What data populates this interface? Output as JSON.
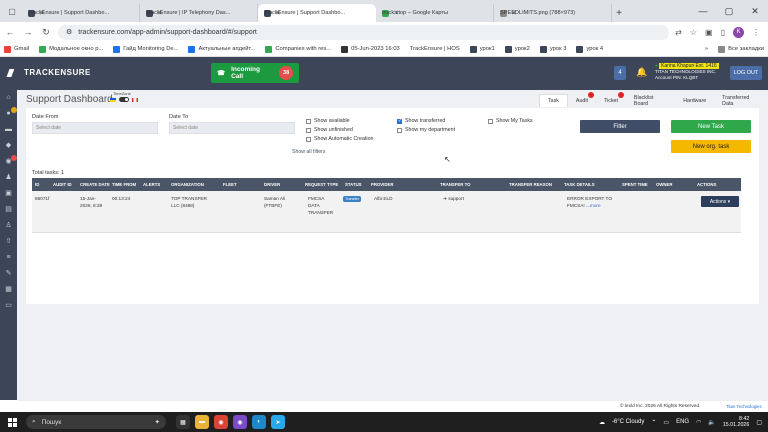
{
  "browser": {
    "tabs": [
      {
        "label": "TrackEnsure | Support Dashbo...",
        "fav": "#3c4658",
        "active": false
      },
      {
        "label": "TrackEnsure | IP Telephony Das...",
        "fav": "#3c4658",
        "active": false
      },
      {
        "label": "TrackEnsure | Support Dashbo...",
        "fav": "#3c4658",
        "active": true
      },
      {
        "label": "truck stop – Google Карты",
        "fav": "#34a853",
        "active": false
      },
      {
        "label": "SPEEDLIMITS.png (788×973)",
        "fav": "#888888",
        "active": false
      }
    ],
    "url": "trackensure.com/app-admin/support-dashboard/#/support",
    "profile_initial": "K",
    "bookmarks": [
      {
        "label": "Gmail",
        "color": "#ea4335"
      },
      {
        "label": "Модальное окно р...",
        "color": "#34a853"
      },
      {
        "label": "Гайд Monitoring De...",
        "color": "#1a73e8"
      },
      {
        "label": "Актуальные апдейт...",
        "color": "#1a73e8"
      },
      {
        "label": "Companies with res...",
        "color": "#34a853"
      },
      {
        "label": "05-Jun-2023 16:03",
        "color": "#333333"
      },
      {
        "label": "TrackEnsure | HOS",
        "color": "#3c4658"
      },
      {
        "label": "урок1",
        "color": "#3c4658"
      },
      {
        "label": "урок2",
        "color": "#3c4658"
      },
      {
        "label": "урок 3",
        "color": "#3c4658"
      },
      {
        "label": "урок 4",
        "color": "#3c4658"
      },
      {
        "label": "»",
        "color": "#ffffff"
      },
      {
        "label": "Все закладки",
        "color": "#888888"
      }
    ]
  },
  "header": {
    "logo": "TRACKENSURE",
    "incoming_call": "Incoming Call",
    "incoming_count": "38",
    "badge": "4",
    "user_name": "Karina Khapun Ext. 1416",
    "company": "TITAN TECHNOLOGIES INC.",
    "account_pin": "Account PIN: KLQBT",
    "logout": "LOG OUT"
  },
  "page": {
    "title": "Support Dashboard",
    "timezone_label": "TimeZone",
    "nav_tabs": [
      "Task",
      "Audit",
      "Ticket",
      "Blacklist Board",
      "Hardware",
      "Transferred Data"
    ],
    "filters": {
      "date_from_label": "Date From",
      "date_from_placeholder": "Select date",
      "date_to_label": "Date To",
      "date_to_placeholder": "Select date",
      "checkboxes": [
        {
          "label": "Show available",
          "checked": false
        },
        {
          "label": "Show unfinished",
          "checked": false
        },
        {
          "label": "Show Automatic Creation",
          "checked": false
        },
        {
          "label": "Show transferred",
          "checked": true
        },
        {
          "label": "Show my department",
          "checked": false
        },
        {
          "label": "Show My Tasks",
          "checked": false
        }
      ],
      "show_all": "Show all filters",
      "filter_btn": "Filter",
      "new_task_btn": "New Task",
      "new_org_task_btn": "New org. task"
    },
    "total_tasks": "Total tasks: 1",
    "columns": [
      "ID",
      "AUDIT ID",
      "CREATE DATE",
      "TIME FROM",
      "ALERTS",
      "ORGANIZATION",
      "FLEET",
      "DRIVER",
      "REQUEST TYPE",
      "STATUS",
      "PROVIDER",
      "TRANSFER TO",
      "TRANSFER REASON",
      "TASK DETAILS",
      "SPENT TIME",
      "OWNER",
      "ACTIONS"
    ],
    "row": {
      "id": "86071f",
      "create_date_1": "15-Jan-",
      "create_date_2": "2026, 8:28",
      "time_from": "00:13:24",
      "org_1": "TOP TRANSFER",
      "org_2": "LLC (8488)",
      "driver_1": "Saman Ali",
      "driver_2": "(FTBFE)",
      "req_1": "FMCSA",
      "req_2": "DATA",
      "req_3": "TRANSFER",
      "status": "Transfer",
      "provider": "Alfa ELD",
      "transfer_to": "➔ support",
      "details_1": "ERROR EXPORT TO",
      "details_2": "FMCSA! ...",
      "details_more": "more",
      "actions": "Actions ▾"
    }
  },
  "footer": {
    "copyright": "© lexld Inc. 2026 All Rights Reserved.",
    "brand": "Titan Technologies"
  },
  "taskbar": {
    "search": "Пошук",
    "weather": "-6°C  Cloudy",
    "lang": "ENG",
    "time": "8:42",
    "date": "15.01.2026"
  }
}
